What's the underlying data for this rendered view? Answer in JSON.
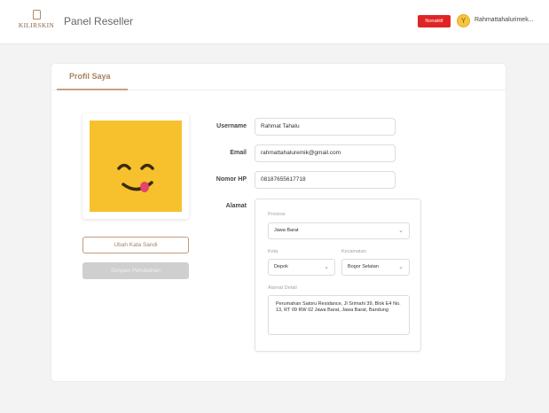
{
  "header": {
    "logo_text": "KILIRSKIN",
    "title": "Panel Reseller",
    "status_badge": "Nonaktif",
    "user_name": "Rahmattahalurimek..."
  },
  "tabs": [
    {
      "label": "Profil Saya",
      "active": true
    }
  ],
  "profile": {
    "change_password_label": "Ubah Kata Sandi",
    "save_changes_label": "Simpan Perubahan"
  },
  "form": {
    "username": {
      "label": "Username",
      "value": "Rahmat Tahalu"
    },
    "email": {
      "label": "Email",
      "value": "rahmattahaluremik@gmail.com"
    },
    "phone": {
      "label": "Nomor HP",
      "value": "08187655617718"
    },
    "address": {
      "label": "Alamat",
      "province_label": "Provinsi",
      "province_value": "Jawa Barat",
      "city_label": "Kota",
      "city_value": "Depok",
      "district_label": "Kecamatan",
      "district_value": "Bogor Selatan",
      "detail_label": "Alamat Detail",
      "detail_value": "Perumahan Satoru Residance, Jl Srimahi 39, Blok E4 No. 13, RT 09 RW 02 Jawa Barat, Jawa Barat, Bandung"
    }
  },
  "colors": {
    "accent": "#a9835f",
    "badge": "#e02424",
    "avatar_bg": "#f6c12c"
  }
}
